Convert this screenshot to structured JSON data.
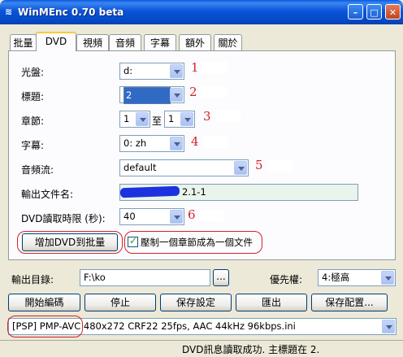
{
  "window": {
    "title": "WinMEnc 0.70 beta",
    "icon_glyph": "≋",
    "minimize_glyph": "–",
    "maximize_glyph": "□",
    "close_glyph": "✕"
  },
  "tabs": [
    "批量",
    "DVD",
    "視頻",
    "音頻",
    "字幕",
    "額外",
    "關於"
  ],
  "dvd": {
    "disc_label": "光盤:",
    "disc_value": "d:",
    "title_label": "標題:",
    "title_value": "2",
    "chapter_label": "章節:",
    "chapter_from": "1",
    "chapter_to_label": "至",
    "chapter_to": "1",
    "subtitle_label": "字幕:",
    "subtitle_value": "0: zh",
    "audio_label": "音頻流:",
    "audio_value": "default",
    "outfile_label": "輸出文件名:",
    "outfile_value": "2.1-1",
    "timeout_label": "DVD讀取時限 (秒):",
    "timeout_value": "40",
    "add_button": "增加DVD到批量",
    "compress_label": "壓制一個章節成為一個文件",
    "compress_checked": true,
    "annotations": [
      "1",
      "2",
      "3",
      "4",
      "5",
      "6"
    ]
  },
  "output": {
    "dir_label": "輸出目錄:",
    "dir_value": "F:\\ko",
    "browse_label": "...",
    "priority_label": "優先權:",
    "priority_value": "4:極高"
  },
  "actions": {
    "start": "開始編碼",
    "stop": "停止",
    "save_settings": "保存設定",
    "export": "匯出",
    "save_config": "保存配置..."
  },
  "preset": {
    "value": "[PSP] PMP-AVC 480x272 CRF22 25fps, AAC 44kHz 96kbps.ini"
  },
  "status": {
    "text": "DVD訊息讀取成功. 主標題在 2."
  },
  "colors": {
    "titlebar": "#0A54D8",
    "annotation_red": "#D2232A",
    "window_bg": "#ECE9D8"
  }
}
